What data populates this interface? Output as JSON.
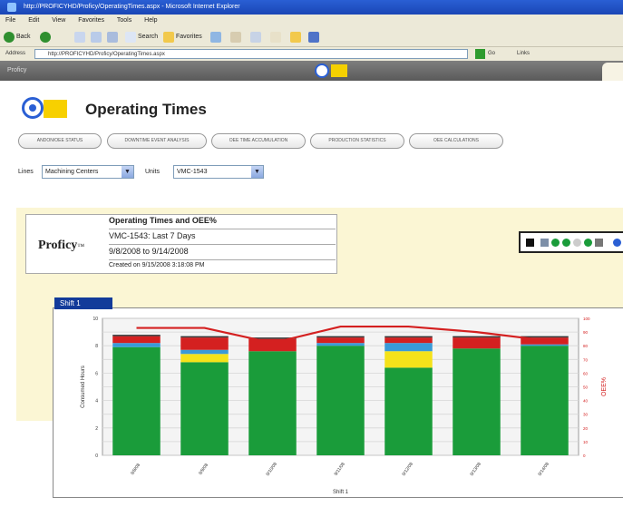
{
  "browser": {
    "title": "http://PROFICYHD/Proficy/OperatingTimes.aspx - Microsoft Internet Explorer",
    "menu": [
      "File",
      "Edit",
      "View",
      "Favorites",
      "Tools",
      "Help"
    ],
    "toolbar": {
      "back": "Back",
      "search": "Search",
      "favorites": "Favorites"
    },
    "address_label": "Address",
    "address_value": "http://PROFICYHD/Proficy/OperatingTimes.aspx",
    "go_label": "Go",
    "links_label": "Links"
  },
  "tabbar": {
    "left_label": "Proficy"
  },
  "page": {
    "title": "Operating Times",
    "nav_buttons": [
      "ANDON/OEE STATUS",
      "DOWNTIME EVENT ANALYSIS",
      "OEE TIME ACCUMULATION",
      "PRODUCTION STATISTICS",
      "OEE CALCULATIONS"
    ],
    "lines_label": "Lines",
    "lines_value": "Machining Centers",
    "units_label": "Units",
    "units_value": "VMC-1543"
  },
  "report_header": {
    "brand": "Proficy",
    "brand_tm": "™",
    "title": "Operating Times and OEE%",
    "subtitle": "VMC-1543: Last 7 Days",
    "range": "9/8/2008 to 9/14/2008",
    "created": "Created on 9/15/2008 3:18:08 PM"
  },
  "chart_tab": "Shift 1",
  "chart_data": {
    "type": "bar",
    "categories": [
      "9/8/08",
      "9/9/08",
      "9/10/08",
      "9/11/08",
      "9/12/08",
      "9/13/08",
      "9/14/08"
    ],
    "xlabel": "Shift 1",
    "ylabel": "Consumed Hours",
    "y2label": "OEE%",
    "ylim": [
      0,
      10
    ],
    "y2lim": [
      0,
      100
    ],
    "yticks": [
      0,
      2,
      4,
      6,
      8,
      10
    ],
    "y2ticks": [
      0,
      10,
      20,
      30,
      40,
      50,
      60,
      70,
      80,
      90,
      100
    ],
    "stacked": true,
    "grid": true,
    "series": [
      {
        "color": "#1a9c3a",
        "values": [
          7.9,
          6.8,
          7.6,
          8.0,
          6.4,
          7.8,
          8.0
        ]
      },
      {
        "color": "#f5e21a",
        "values": [
          0.0,
          0.6,
          0.0,
          0.0,
          1.2,
          0.0,
          0.0
        ]
      },
      {
        "color": "#3a9ad8",
        "values": [
          0.3,
          0.3,
          0.0,
          0.2,
          0.6,
          0.0,
          0.1
        ]
      },
      {
        "color": "#d42020",
        "values": [
          0.5,
          0.9,
          0.9,
          0.4,
          0.4,
          0.8,
          0.5
        ]
      },
      {
        "color": "#333333",
        "values": [
          0.1,
          0.1,
          0.1,
          0.1,
          0.1,
          0.1,
          0.1
        ]
      }
    ],
    "line": {
      "color": "#d42020",
      "values": [
        93,
        93,
        82,
        94,
        94,
        90,
        84
      ]
    }
  },
  "colors": {
    "accent": "#123b9a",
    "panel": "#fbf6d4",
    "logo_yellow": "#f7d000"
  }
}
